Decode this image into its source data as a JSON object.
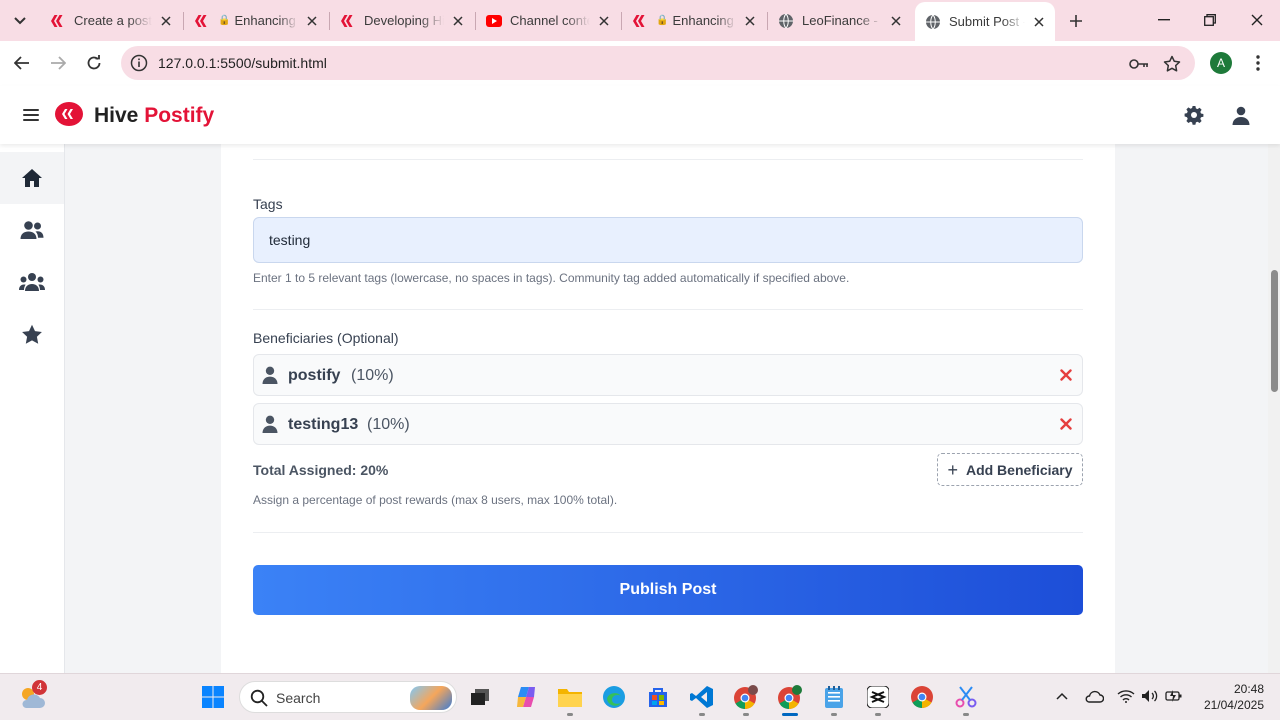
{
  "browser": {
    "tabs": [
      {
        "title": "Create a post",
        "favicon": "hive-icon",
        "locked": false
      },
      {
        "title": "Enhancing Hive",
        "favicon": "hive-icon",
        "locked": true
      },
      {
        "title": "Developing Hive",
        "favicon": "hive-icon",
        "locked": false
      },
      {
        "title": "Channel content",
        "favicon": "youtube-icon",
        "locked": false
      },
      {
        "title": "Enhancing Hive",
        "favicon": "hive-icon",
        "locked": true
      },
      {
        "title": "LeoFinance - Hive",
        "favicon": "globe-icon",
        "locked": false
      },
      {
        "title": "Submit Post - Hive",
        "favicon": "globe-icon",
        "locked": false,
        "active": true
      }
    ],
    "url": "127.0.0.1:5500/submit.html",
    "profile_initial": "A"
  },
  "app": {
    "brand_main": "Hive",
    "brand_accent": "Postify",
    "accent_color": "#e31337"
  },
  "sidebar": {
    "items": [
      {
        "icon": "home-icon",
        "active": true
      },
      {
        "icon": "users-icon",
        "active": false
      },
      {
        "icon": "community-icon",
        "active": false
      },
      {
        "icon": "star-icon",
        "active": false
      }
    ]
  },
  "form": {
    "tags_label": "Tags",
    "tags_value": "testing",
    "tags_help": "Enter 1 to 5 relevant tags (lowercase, no spaces in tags). Community tag added automatically if specified above.",
    "beneficiaries_label": "Beneficiaries (Optional)",
    "beneficiaries": [
      {
        "name": "postify",
        "percent": "(10%)"
      },
      {
        "name": "testing13",
        "percent": "(10%)"
      }
    ],
    "total_assigned": "Total Assigned: 20%",
    "add_beneficiary_label": "Add Beneficiary",
    "beneficiaries_help": "Assign a percentage of post rewards (max 8 users, max 100% total).",
    "publish_label": "Publish Post",
    "publish_gradient": [
      "#3b82f6",
      "#1d4ed8"
    ]
  },
  "taskbar": {
    "weather_badge": "4",
    "search_placeholder": "Search",
    "time": "20:48",
    "date": "21/04/2025"
  }
}
